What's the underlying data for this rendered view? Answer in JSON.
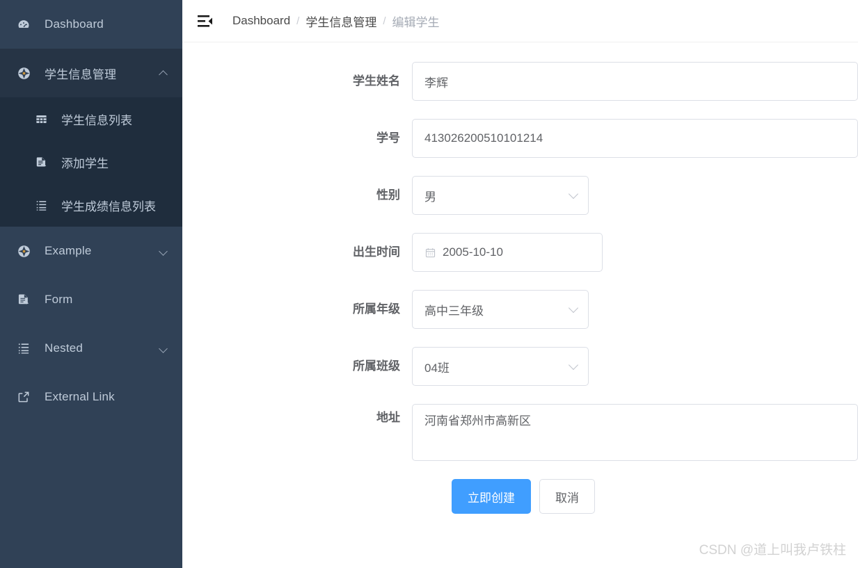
{
  "sidebar": {
    "bg_color": "#304156",
    "submenu_bg_color": "#1f2d3d",
    "items": [
      {
        "label": "Dashboard",
        "icon": "dashboard-gauge-icon",
        "has_chevron": false,
        "expanded": false
      },
      {
        "label": "学生信息管理",
        "icon": "compass-icon",
        "has_chevron": true,
        "expanded": true
      },
      {
        "label": "Example",
        "icon": "compass-icon",
        "has_chevron": true,
        "expanded": false
      },
      {
        "label": "Form",
        "icon": "document-edit-icon",
        "has_chevron": false,
        "expanded": false
      },
      {
        "label": "Nested",
        "icon": "tree-list-icon",
        "has_chevron": true,
        "expanded": false
      },
      {
        "label": "External Link",
        "icon": "external-link-icon",
        "has_chevron": false,
        "expanded": false
      }
    ],
    "submenu": [
      {
        "label": "学生信息列表",
        "icon": "table-grid-icon"
      },
      {
        "label": "添加学生",
        "icon": "document-edit-icon"
      },
      {
        "label": "学生成绩信息列表",
        "icon": "tree-list-icon"
      }
    ]
  },
  "topbar": {
    "hamburger_icon": "hamburger-collapse-icon",
    "breadcrumb": [
      {
        "label": "Dashboard",
        "current": false
      },
      {
        "label": "学生信息管理",
        "current": false
      },
      {
        "label": "编辑学生",
        "current": true
      }
    ],
    "separator": "/"
  },
  "form": {
    "fields": [
      {
        "label": "学生姓名",
        "type": "text",
        "value": "李辉",
        "width": "wide"
      },
      {
        "label": "学号",
        "type": "text",
        "value": "413026200510101214",
        "width": "wide"
      },
      {
        "label": "性别",
        "type": "select",
        "value": "男",
        "width": "narrow"
      },
      {
        "label": "出生时间",
        "type": "date",
        "value": "2005-10-10",
        "width": "date",
        "icon": "calendar-icon"
      },
      {
        "label": "所属年级",
        "type": "select",
        "value": "高中三年级",
        "width": "narrow"
      },
      {
        "label": "所属班级",
        "type": "select",
        "value": "04班",
        "width": "narrow"
      },
      {
        "label": "地址",
        "type": "textarea",
        "value": "河南省郑州市高新区",
        "width": "wide"
      }
    ],
    "submit_label": "立即创建",
    "cancel_label": "取消",
    "primary_color": "#409eff"
  },
  "watermark": "CSDN @道上叫我卢铁柱"
}
